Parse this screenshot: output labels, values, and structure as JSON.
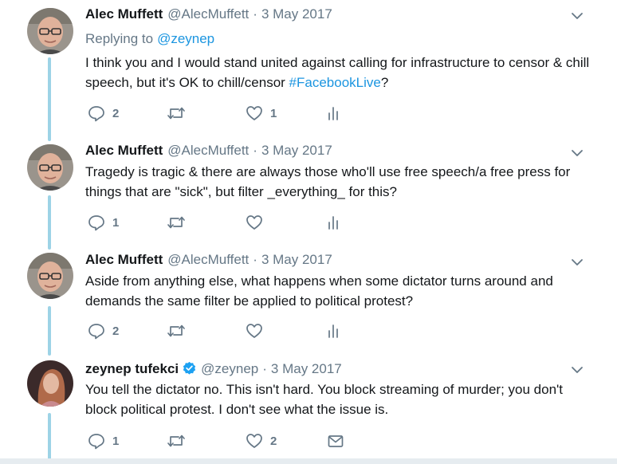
{
  "tweets": [
    {
      "name": "Alec Muffett",
      "handle": "@AlecMuffett",
      "separator": "·",
      "date": "3 May 2017",
      "replying_prefix": "Replying to",
      "replying_handle": "@zeynep",
      "text_main": "I think you and I would stand united against calling for infrastructure to censor & chill speech, but it's OK to chill/censor ",
      "hashtag": "#FacebookLive",
      "text_tail": "?",
      "replies": "2",
      "retweets": "",
      "likes": "1",
      "verified": false
    },
    {
      "name": "Alec Muffett",
      "handle": "@AlecMuffett",
      "separator": "·",
      "date": "3 May 2017",
      "text_main": "Tragedy is tragic & there are always those who'll use free speech/a free press for things that are \"sick\", but filter _everything_ for this?",
      "replies": "1",
      "retweets": "",
      "likes": "",
      "verified": false
    },
    {
      "name": "Alec Muffett",
      "handle": "@AlecMuffett",
      "separator": "·",
      "date": "3 May 2017",
      "text_main": "Aside from anything else, what happens when some dictator turns around and demands the same filter be applied to political protest?",
      "replies": "2",
      "retweets": "",
      "likes": "",
      "verified": false
    },
    {
      "name": "zeynep tufekci",
      "handle": "@zeynep",
      "separator": "·",
      "date": "3 May 2017",
      "text_main": "You tell the dictator no. This isn't hard. You block streaming of murder; you don't block political protest. I don't see what the issue is.",
      "replies": "1",
      "retweets": "",
      "likes": "2",
      "verified": true
    }
  ],
  "icons": {
    "reply": "reply-icon",
    "retweet": "retweet-icon",
    "like": "heart-icon",
    "analytics": "analytics-icon",
    "dm": "envelope-icon",
    "caret": "chevron-down-icon",
    "verified": "verified-badge-icon"
  },
  "colors": {
    "link": "#1b95e0",
    "meta": "#657786",
    "thread_line": "#9dd3e6",
    "verified": "#1da1f2"
  }
}
